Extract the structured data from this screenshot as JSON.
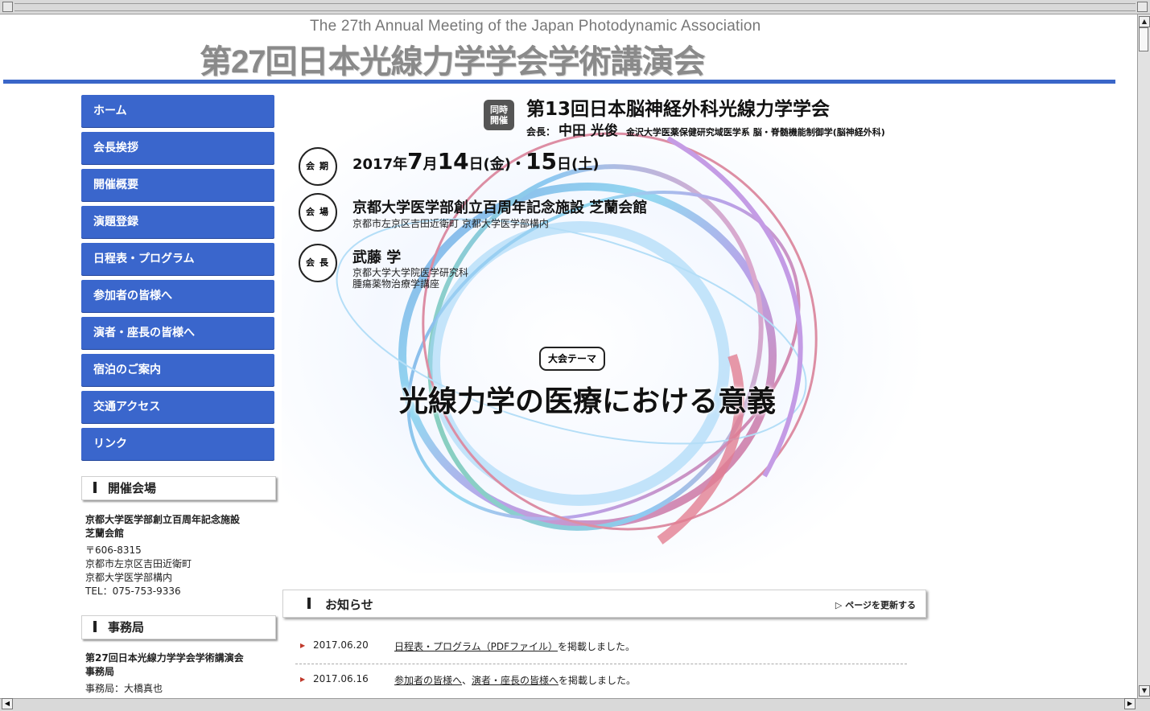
{
  "header": {
    "subtitle_en": "The 27th Annual Meeting of the Japan Photodynamic Association",
    "title_ja": "第27回日本光線力学学会学術講演会"
  },
  "nav": {
    "items": [
      {
        "label": "ホーム"
      },
      {
        "label": "会長挨拶"
      },
      {
        "label": "開催概要"
      },
      {
        "label": "演題登録"
      },
      {
        "label": "日程表・プログラム"
      },
      {
        "label": "参加者の皆様へ"
      },
      {
        "label": "演者・座長の皆様へ"
      },
      {
        "label": "宿泊のご案内"
      },
      {
        "label": "交通アクセス"
      },
      {
        "label": "リンク"
      }
    ]
  },
  "venue_box": {
    "heading": "開催会場",
    "name": "京都大学医学部創立百周年記念施設\n芝蘭会館",
    "postal": "〒606-8315",
    "address1": "京都市左京区吉田近衛町",
    "address2": "京都大学医学部構内",
    "tel": "TEL：075-753-9336"
  },
  "office_box": {
    "heading": "事務局",
    "name": "第27回日本光線力学学会学術講演会\n事務局",
    "person": "事務局：大橋真也"
  },
  "hero": {
    "joint_badge": "同時\n開催",
    "joint_title": "第13回日本脳神経外科光線力学学会",
    "joint_president_label": "会長：",
    "joint_president_name": "中田 光俊",
    "joint_president_aff": "金沢大学医薬保健研究域医学系 脳・脊髄機能制御学(脳神経外科)",
    "period_label": "会期",
    "date_prefix": "2017",
    "date_month1": "7",
    "date_m_char": "月",
    "date_day1": "14",
    "date_day1_suffix": "日(金)・",
    "date_day2": "15",
    "date_day2_suffix": "日(土)",
    "venue_label": "会場",
    "venue_name": "京都大学医学部創立百周年記念施設 芝蘭会館",
    "venue_address": "京都市左京区吉田近衛町 京都大学医学部構内",
    "president_label": "会長",
    "president_name": "武藤 学",
    "president_aff1": "京都大学大学院医学研究科",
    "president_aff2": "腫瘍薬物治療学講座",
    "theme_tag": "大会テーマ",
    "theme": "光線力学の医療における意義"
  },
  "news": {
    "heading": "お知らせ",
    "refresh": "▷ ページを更新する",
    "items": [
      {
        "date": "2017.06.20",
        "link1": "日程表・プログラム（PDFファイル）",
        "sep": "",
        "link2": "",
        "rest": "を掲載しました。"
      },
      {
        "date": "2017.06.16",
        "link1": "参加者の皆様へ",
        "sep": "、",
        "link2": "演者・座長の皆様へ",
        "rest": "を掲載しました。"
      }
    ]
  },
  "colors": {
    "nav_blue": "#3a66cc",
    "header_rule": "#3a66c8",
    "title_gray": "#8a8a8a"
  }
}
